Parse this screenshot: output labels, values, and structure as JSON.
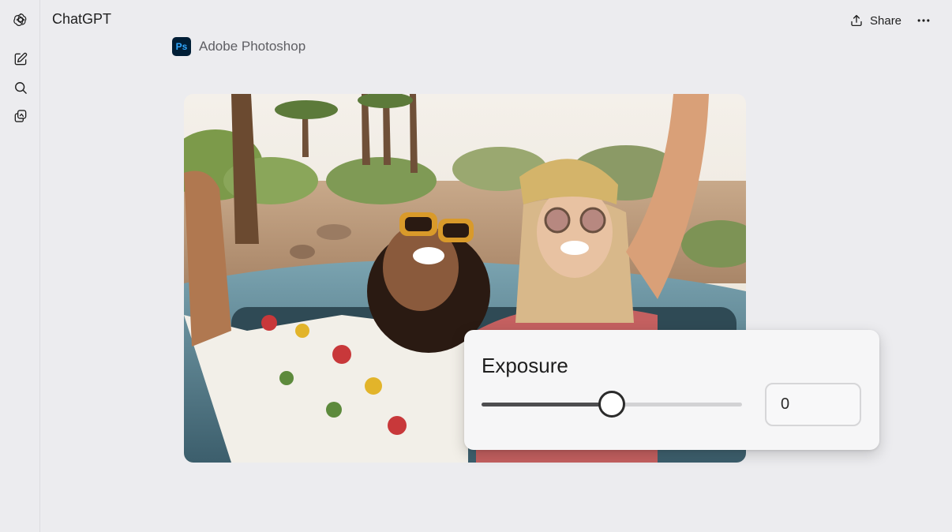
{
  "app": {
    "title": "ChatGPT"
  },
  "header": {
    "share_label": "Share"
  },
  "sidebar": {
    "items": [
      {
        "icon": "openai-logo-icon"
      },
      {
        "icon": "new-chat-icon"
      },
      {
        "icon": "search-icon"
      },
      {
        "icon": "library-icon"
      }
    ]
  },
  "app_tag": {
    "name": "Adobe Photoshop",
    "logo_text": "Ps"
  },
  "exposure": {
    "label": "Exposure",
    "value": "0",
    "level": 0.5
  },
  "colors": {
    "background": "#ececef",
    "ps_logo_bg": "#001e36",
    "ps_logo_text": "#31a8ff"
  }
}
